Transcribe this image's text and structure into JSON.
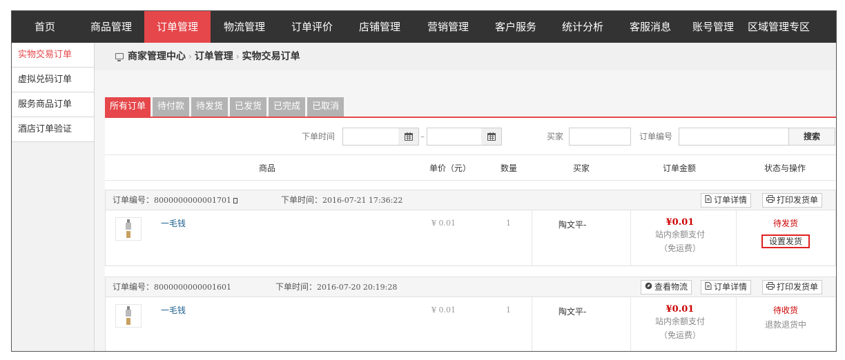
{
  "topnav": {
    "items": [
      "首页",
      "商品管理",
      "订单管理",
      "物流管理",
      "订单评价",
      "店铺管理",
      "营销管理",
      "客户服务",
      "统计分析",
      "客服消息",
      "账号管理",
      "区域管理专区"
    ],
    "active_index": 2
  },
  "sidebar": {
    "items": [
      "实物交易订单",
      "虚拟兑码订单",
      "服务商品订单",
      "酒店订单验证"
    ],
    "active_index": 0
  },
  "breadcrumb": {
    "root": "商家管理中心",
    "level1": "订单管理",
    "current": "实物交易订单",
    "separator": "›"
  },
  "tabs": {
    "items": [
      "所有订单",
      "待付款",
      "待发货",
      "已发货",
      "已完成",
      "已取消"
    ],
    "active_index": 0
  },
  "filter": {
    "order_time_label": "下单时间",
    "range_dash": "–",
    "buyer_label": "买家",
    "order_no_label": "订单编号",
    "search_button": "搜索"
  },
  "table_header": {
    "product": "商品",
    "unit_price": "单价（元）",
    "quantity": "数量",
    "buyer": "买家",
    "amount": "订单金额",
    "status": "状态与操作"
  },
  "orders": [
    {
      "order_no_label": "订单编号：",
      "order_no": "8000000000001701",
      "order_time_label": "下单时间：",
      "order_time": "2016-07-21 17:36:22",
      "buttons": {
        "detail": "订单详情",
        "print": "打印发货单"
      },
      "product_name": "一毛钱",
      "price": "¥ 0.01",
      "quantity": "1",
      "buyer": "陶文平-",
      "amount": "¥0.01",
      "payment": "站内余额支付",
      "shipping": "（免运费）",
      "status": "待发货",
      "action": "设置发货"
    },
    {
      "order_no_label": "订单编号：",
      "order_no": "8000000000001601",
      "order_time_label": "下单时间：",
      "order_time": "2016-07-20 20:19:28",
      "buttons": {
        "logistics": "查看物流",
        "detail": "订单详情",
        "print": "打印发货单"
      },
      "product_name": "一毛钱",
      "price": "¥ 0.01",
      "quantity": "1",
      "buyer": "陶文平-",
      "amount": "¥0.01",
      "payment": "站内余额支付",
      "shipping": "（免运费）",
      "status": "待收货",
      "sub_status": "退款退货中"
    }
  ],
  "colors": {
    "accent": "#e5474b",
    "nav_bg": "#333333",
    "tab_inactive": "#b3b3b3",
    "price_red": "#cc0000",
    "link_blue": "#1a5d8c",
    "highlight_border": "#e02020"
  }
}
